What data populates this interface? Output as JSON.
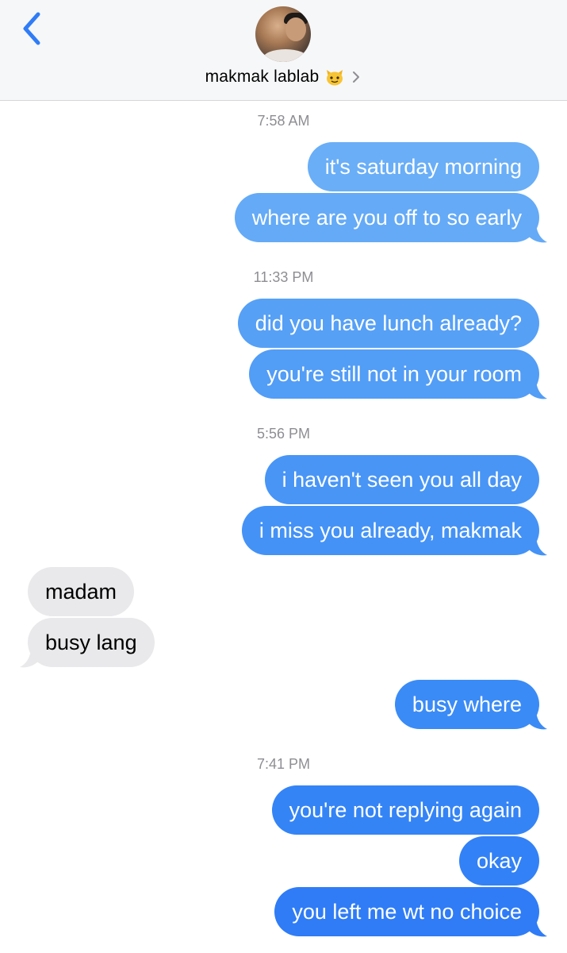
{
  "header": {
    "contact_name": "makmak lablab",
    "contact_emoji": "cat-face-emoji",
    "back_icon": "chevron-left-icon",
    "disclosure_icon": "chevron-right-icon"
  },
  "colors": {
    "accent": "#2f7cf6",
    "outgoing_top": "#6bb0f7",
    "outgoing_bottom": "#2f7cf6",
    "incoming": "#e9e9eb",
    "timestamp": "#8e8e93"
  },
  "conversation": {
    "timestamps": [
      "7:58 AM",
      "11:33 PM",
      "5:56 PM",
      "7:41 PM"
    ],
    "messages": [
      {
        "direction": "outgoing",
        "text": "it's saturday morning"
      },
      {
        "direction": "outgoing",
        "text": "where are you off to so early"
      },
      {
        "direction": "outgoing",
        "text": "did you have lunch already?"
      },
      {
        "direction": "outgoing",
        "text": "you're still not in your room"
      },
      {
        "direction": "outgoing",
        "text": "i haven't seen you all day"
      },
      {
        "direction": "outgoing",
        "text": "i miss you already, makmak"
      },
      {
        "direction": "incoming",
        "text": "madam"
      },
      {
        "direction": "incoming",
        "text": "busy lang"
      },
      {
        "direction": "outgoing",
        "text": "busy where"
      },
      {
        "direction": "outgoing",
        "text": "you're not replying again"
      },
      {
        "direction": "outgoing",
        "text": "okay"
      },
      {
        "direction": "outgoing",
        "text": "you left me wt no choice"
      }
    ]
  }
}
